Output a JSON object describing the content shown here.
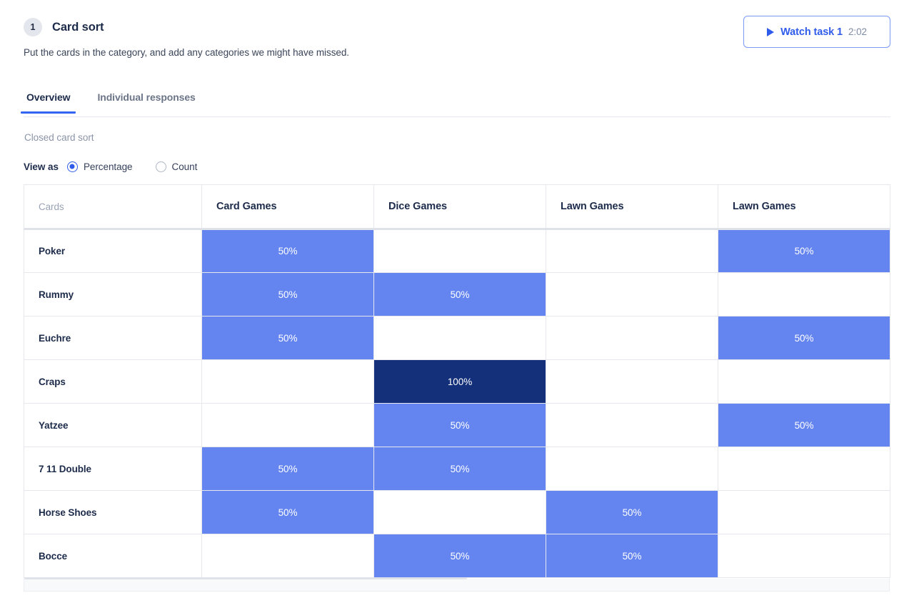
{
  "header": {
    "badge_number": "1",
    "title": "Card sort",
    "description": "Put the cards in the category, and add any categories we might have missed.",
    "watch_button": {
      "label": "Watch task 1",
      "duration": "2:02",
      "icon": "play-icon"
    }
  },
  "tabs": [
    {
      "label": "Overview",
      "active": true
    },
    {
      "label": "Individual responses",
      "active": false
    }
  ],
  "sort_type": "Closed card sort",
  "view_as": {
    "label": "View as",
    "options": [
      {
        "label": "Percentage",
        "selected": true
      },
      {
        "label": "Count",
        "selected": false
      }
    ]
  },
  "colors": {
    "accent_blue": "#3366f0",
    "cell_mid": "#6485f0",
    "cell_full": "#14307a",
    "text_dark": "#1d2b4b",
    "text_muted": "#9aa2b4",
    "border": "#e6e8ee"
  },
  "chart_data": {
    "type": "heatmap",
    "title": "Card sort",
    "subtitle": "Closed card sort",
    "value_format": "percentage",
    "xlabel": "",
    "ylabel": "Cards",
    "cards_header": "Cards",
    "categories": [
      "Card Games",
      "Dice Games",
      "Lawn Games",
      "Lawn Games"
    ],
    "cards": [
      "Poker",
      "Rummy",
      "Euchre",
      "Craps",
      "Yatzee",
      "7 11 Double",
      "Horse Shoes",
      "Bocce"
    ],
    "rows": [
      {
        "card": "Poker",
        "values": [
          50,
          null,
          null,
          50
        ]
      },
      {
        "card": "Rummy",
        "values": [
          50,
          50,
          null,
          null
        ]
      },
      {
        "card": "Euchre",
        "values": [
          50,
          null,
          null,
          50
        ]
      },
      {
        "card": "Craps",
        "values": [
          null,
          100,
          null,
          null
        ]
      },
      {
        "card": "Yatzee",
        "values": [
          null,
          50,
          null,
          50
        ]
      },
      {
        "card": "7 11 Double",
        "values": [
          50,
          50,
          null,
          null
        ]
      },
      {
        "card": "Horse Shoes",
        "values": [
          50,
          null,
          50,
          null
        ]
      },
      {
        "card": "Bocce",
        "values": [
          null,
          50,
          50,
          null
        ]
      }
    ],
    "cells": [
      [
        "50%",
        "",
        "",
        "50%"
      ],
      [
        "50%",
        "50%",
        "",
        ""
      ],
      [
        "50%",
        "",
        "",
        "50%"
      ],
      [
        "",
        "100%",
        "",
        ""
      ],
      [
        "",
        "50%",
        "",
        "50%"
      ],
      [
        "50%",
        "50%",
        "",
        ""
      ],
      [
        "50%",
        "",
        "50%",
        ""
      ],
      [
        "",
        "50%",
        "50%",
        ""
      ]
    ],
    "zlim": [
      0,
      100
    ],
    "legend": "none",
    "grid": true
  }
}
